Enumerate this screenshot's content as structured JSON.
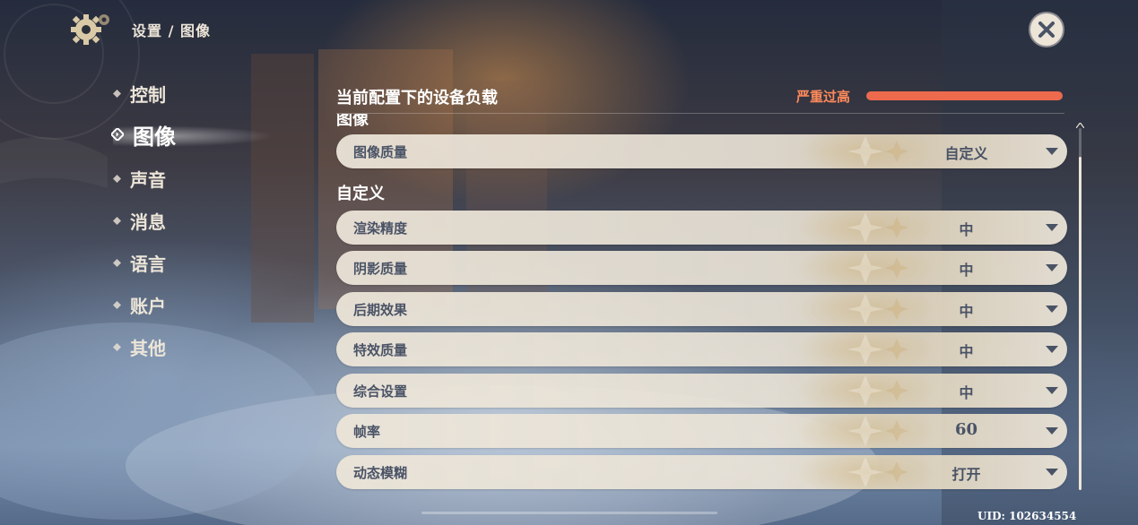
{
  "header": {
    "breadcrumb": "设置 / 图像",
    "icons": {
      "settings": "gear-icon",
      "close": "close-icon"
    }
  },
  "nav": {
    "items": [
      {
        "label": "控制",
        "active": false
      },
      {
        "label": "图像",
        "active": true
      },
      {
        "label": "声音",
        "active": false
      },
      {
        "label": "消息",
        "active": false
      },
      {
        "label": "语言",
        "active": false
      },
      {
        "label": "账户",
        "active": false
      },
      {
        "label": "其他",
        "active": false
      }
    ]
  },
  "device_load": {
    "title": "当前配置下的设备负载",
    "status": "严重过高",
    "level_fraction": 1.0
  },
  "sections": {
    "image": {
      "title": "图像",
      "quality_label": "图像质量",
      "quality_value": "自定义"
    },
    "custom": {
      "title": "自定义",
      "rows": [
        {
          "label": "渲染精度",
          "value": "中"
        },
        {
          "label": "阴影质量",
          "value": "中"
        },
        {
          "label": "后期效果",
          "value": "中"
        },
        {
          "label": "特效质量",
          "value": "中"
        },
        {
          "label": "综合设置",
          "value": "中"
        },
        {
          "label": "帧率",
          "value": "60"
        },
        {
          "label": "动态模糊",
          "value": "打开"
        }
      ]
    }
  },
  "uid_text": "UID: 102634554",
  "colors": {
    "text_light": "#ece5d8",
    "row_text": "#4a5366",
    "load_status": "#ff8a5b",
    "load_fill": "#ee6a4d"
  }
}
